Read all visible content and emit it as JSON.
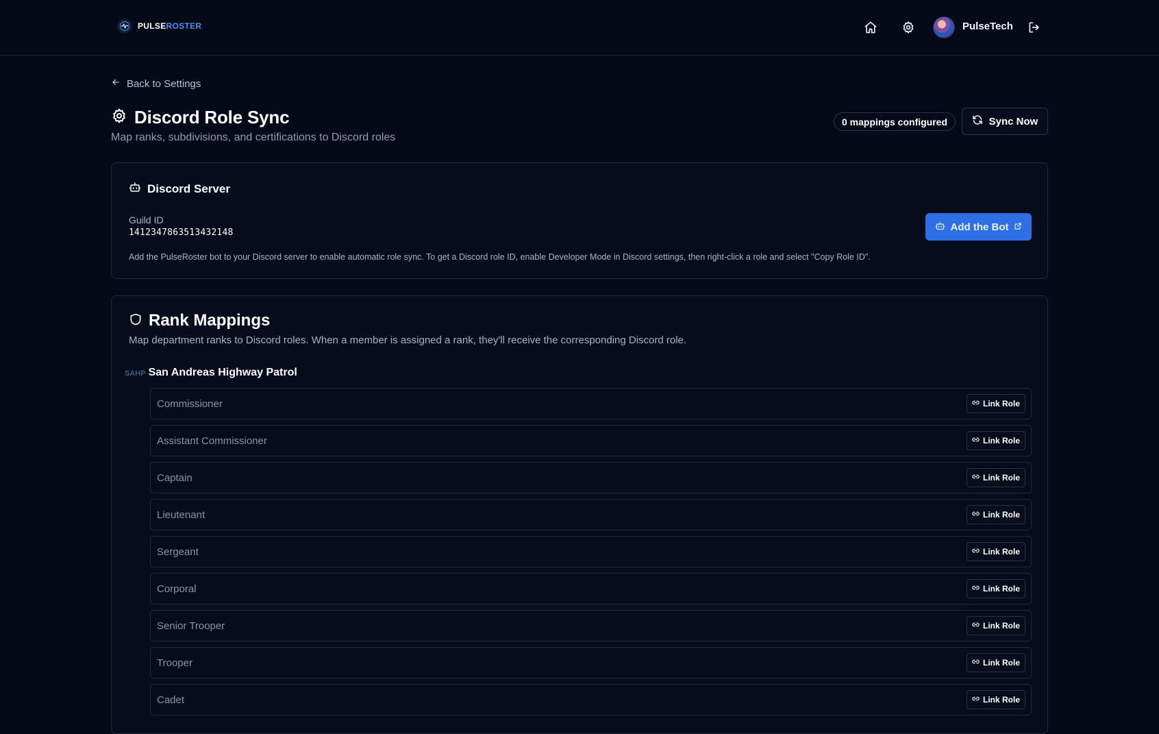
{
  "header": {
    "logo_a": "PULSE",
    "logo_b": "ROSTER",
    "username": "PulseTech"
  },
  "page": {
    "back_label": "Back to Settings",
    "title": "Discord Role Sync",
    "subtitle": "Map ranks, subdivisions, and certifications to Discord roles",
    "mappings_badge": "0 mappings configured",
    "sync_label": "Sync Now"
  },
  "server": {
    "title": "Discord Server",
    "guild_label": "Guild ID",
    "guild_id": "1412347863513432148",
    "help_text": "Add the PulseRoster bot to your Discord server to enable automatic role sync. To get a Discord role ID, enable Developer Mode in Discord settings, then right-click a role and select \"Copy Role ID\".",
    "add_bot_label": "Add the Bot"
  },
  "ranks": {
    "title": "Rank Mappings",
    "description": "Map department ranks to Discord roles. When a member is assigned a rank, they'll receive the corresponding Discord role.",
    "department_abbr": "SAHP",
    "department_name": "San Andreas Highway Patrol",
    "link_label": "Link Role",
    "items": [
      {
        "name": "Commissioner"
      },
      {
        "name": "Assistant Commissioner"
      },
      {
        "name": "Captain"
      },
      {
        "name": "Lieutenant"
      },
      {
        "name": "Sergeant"
      },
      {
        "name": "Corporal"
      },
      {
        "name": "Senior Trooper"
      },
      {
        "name": "Trooper"
      },
      {
        "name": "Cadet"
      }
    ]
  },
  "colors": {
    "background": "#050a18",
    "accent": "#2e6fe6",
    "logo_accent": "#4d8ff0"
  }
}
